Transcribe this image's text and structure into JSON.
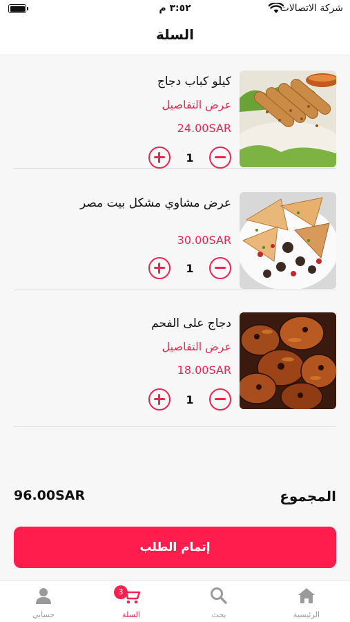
{
  "status_bar": {
    "carrier": "شركة الاتصالات",
    "time": "٣:٥٢ م"
  },
  "nav": {
    "title": "السلة"
  },
  "cart": {
    "items": [
      {
        "name": "كيلو كباب دجاج",
        "details_link": "عرض التفاصيل",
        "price": "24.00SAR",
        "quantity": "1",
        "image": "kebab-image"
      },
      {
        "name": "عرض مشاوي مشكل بيت مصر",
        "details_link": "",
        "price": "30.00SAR",
        "quantity": "1",
        "image": "mixed-grill-image"
      },
      {
        "name": "دجاج على الفحم",
        "details_link": "عرض التفاصيل",
        "price": "18.00SAR",
        "quantity": "1",
        "image": "grilled-chicken-image"
      }
    ],
    "total_label": "المجموع",
    "total_value": "96.00SAR",
    "checkout_label": "إتمام الطلب"
  },
  "tab_bar": {
    "tabs": [
      {
        "label": "الرئيسية",
        "icon": "home-icon"
      },
      {
        "label": "بحث",
        "icon": "search-icon"
      },
      {
        "label": "السلة",
        "icon": "cart-icon",
        "badge": "3"
      },
      {
        "label": "حسابي",
        "icon": "user-icon"
      }
    ]
  },
  "colors": {
    "accent": "#f0244f",
    "button": "#ff1d4e",
    "muted": "#9a9a9a"
  }
}
